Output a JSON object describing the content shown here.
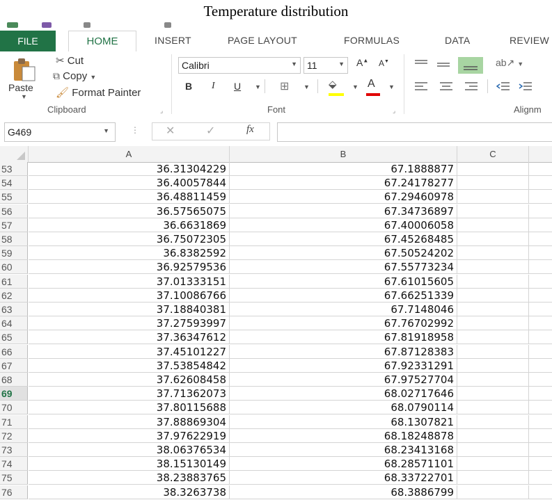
{
  "caption": "Temperature distribution",
  "tabs": {
    "file": "FILE",
    "home": "HOME",
    "insert": "INSERT",
    "page_layout": "PAGE LAYOUT",
    "formulas": "FORMULAS",
    "data": "DATA",
    "review": "REVIEW"
  },
  "clipboard": {
    "paste": "Paste",
    "cut": "Cut",
    "copy": "Copy",
    "format_painter": "Format Painter",
    "group_label": "Clipboard"
  },
  "font": {
    "name": "Calibri",
    "size": "11",
    "bold": "B",
    "italic": "I",
    "underline": "U",
    "font_color_letter": "A",
    "group_label": "Font"
  },
  "alignment": {
    "group_label": "Alignm"
  },
  "formula_bar": {
    "name_box": "G469",
    "fx": "fx",
    "value": ""
  },
  "columns": [
    "A",
    "B",
    "C"
  ],
  "selected_row": "69",
  "rows": [
    {
      "n": "53",
      "a": "36.31304229",
      "b": "67.1888877"
    },
    {
      "n": "54",
      "a": "36.40057844",
      "b": "67.24178277"
    },
    {
      "n": "55",
      "a": "36.48811459",
      "b": "67.29460978"
    },
    {
      "n": "56",
      "a": "36.57565075",
      "b": "67.34736897"
    },
    {
      "n": "57",
      "a": "36.6631869",
      "b": "67.40006058"
    },
    {
      "n": "58",
      "a": "36.75072305",
      "b": "67.45268485"
    },
    {
      "n": "59",
      "a": "36.8382592",
      "b": "67.50524202"
    },
    {
      "n": "60",
      "a": "36.92579536",
      "b": "67.55773234"
    },
    {
      "n": "61",
      "a": "37.01333151",
      "b": "67.61015605"
    },
    {
      "n": "62",
      "a": "37.10086766",
      "b": "67.66251339"
    },
    {
      "n": "63",
      "a": "37.18840381",
      "b": "67.7148046"
    },
    {
      "n": "64",
      "a": "37.27593997",
      "b": "67.76702992"
    },
    {
      "n": "65",
      "a": "37.36347612",
      "b": "67.81918958"
    },
    {
      "n": "66",
      "a": "37.45101227",
      "b": "67.87128383"
    },
    {
      "n": "67",
      "a": "37.53854842",
      "b": "67.92331291"
    },
    {
      "n": "68",
      "a": "37.62608458",
      "b": "67.97527704"
    },
    {
      "n": "69",
      "a": "37.71362073",
      "b": "68.02717646"
    },
    {
      "n": "70",
      "a": "37.80115688",
      "b": "68.0790114"
    },
    {
      "n": "71",
      "a": "37.88869304",
      "b": "68.1307821"
    },
    {
      "n": "72",
      "a": "37.97622919",
      "b": "68.18248878"
    },
    {
      "n": "73",
      "a": "38.06376534",
      "b": "68.23413168"
    },
    {
      "n": "74",
      "a": "38.15130149",
      "b": "68.28571101"
    },
    {
      "n": "75",
      "a": "38.23883765",
      "b": "68.33722701"
    },
    {
      "n": "76",
      "a": "38.3263738",
      "b": "68.3886799"
    }
  ],
  "colors": {
    "accent": "#217346",
    "fill_yellow": "#ffff00",
    "font_red": "#e00000",
    "align_active": "#a8d5a2"
  }
}
